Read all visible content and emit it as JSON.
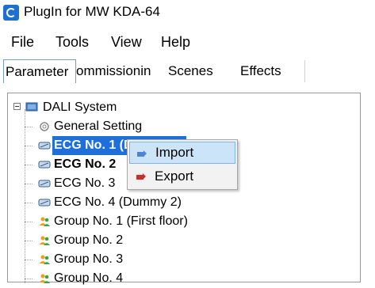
{
  "window": {
    "title": "PlugIn for MW KDA-64"
  },
  "menu": {
    "items": [
      "File",
      "Tools",
      "View",
      "Help"
    ]
  },
  "tabs": {
    "items": [
      "Parameter",
      "ommissionin",
      "Scenes",
      "Effects"
    ]
  },
  "tree": {
    "root": "DALI System",
    "items": [
      "General Setting",
      "ECG No. 1 (Dummy 1)",
      "ECG No. 2",
      "ECG No. 3",
      "ECG No. 4 (Dummy 2)",
      "Group No. 1 (First floor)",
      "Group No. 2",
      "Group No. 3",
      "Group No. 4"
    ]
  },
  "context_menu": {
    "items": [
      "Import",
      "Export"
    ]
  },
  "colors": {
    "selection": "#1e6fd9",
    "hover": "#cce4f7",
    "accent": "#1f6fd1"
  }
}
